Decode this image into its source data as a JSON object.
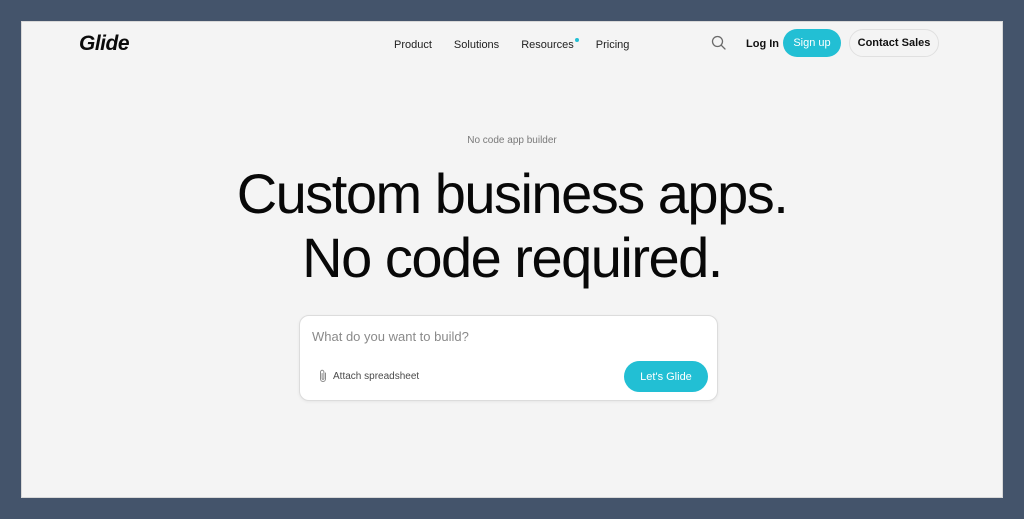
{
  "colors": {
    "accent": "#22bfd4",
    "frame_background": "#44546b",
    "page_background": "#f4f4f4",
    "text_primary": "#080808"
  },
  "nav": {
    "logo": "Glide",
    "links": [
      {
        "label": "Product"
      },
      {
        "label": "Solutions"
      },
      {
        "label": "Resources",
        "has_indicator": true
      },
      {
        "label": "Pricing"
      }
    ],
    "search_icon": "search-icon",
    "login_label": "Log In",
    "signup_label": "Sign up",
    "contact_label": "Contact Sales"
  },
  "hero": {
    "eyebrow": "No code app builder",
    "headline_line1": "Custom business apps.",
    "headline_line2": "No code required."
  },
  "prompt": {
    "placeholder": "What do you want to build?",
    "value": "",
    "attach_icon": "paperclip-icon",
    "attach_label": "Attach spreadsheet",
    "submit_label": "Let's Glide"
  }
}
